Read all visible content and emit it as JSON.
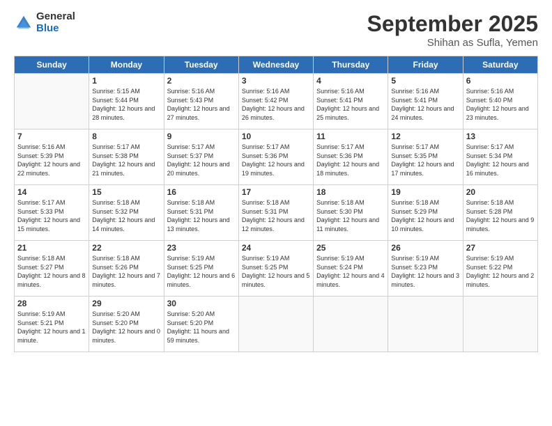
{
  "header": {
    "logo_general": "General",
    "logo_blue": "Blue",
    "month_title": "September 2025",
    "location": "Shihan as Sufla, Yemen"
  },
  "days_of_week": [
    "Sunday",
    "Monday",
    "Tuesday",
    "Wednesday",
    "Thursday",
    "Friday",
    "Saturday"
  ],
  "weeks": [
    [
      {
        "num": "",
        "empty": true
      },
      {
        "num": "1",
        "sunrise": "5:15 AM",
        "sunset": "5:44 PM",
        "daylight": "12 hours and 28 minutes."
      },
      {
        "num": "2",
        "sunrise": "5:16 AM",
        "sunset": "5:43 PM",
        "daylight": "12 hours and 27 minutes."
      },
      {
        "num": "3",
        "sunrise": "5:16 AM",
        "sunset": "5:42 PM",
        "daylight": "12 hours and 26 minutes."
      },
      {
        "num": "4",
        "sunrise": "5:16 AM",
        "sunset": "5:41 PM",
        "daylight": "12 hours and 25 minutes."
      },
      {
        "num": "5",
        "sunrise": "5:16 AM",
        "sunset": "5:41 PM",
        "daylight": "12 hours and 24 minutes."
      },
      {
        "num": "6",
        "sunrise": "5:16 AM",
        "sunset": "5:40 PM",
        "daylight": "12 hours and 23 minutes."
      }
    ],
    [
      {
        "num": "7",
        "sunrise": "5:16 AM",
        "sunset": "5:39 PM",
        "daylight": "12 hours and 22 minutes."
      },
      {
        "num": "8",
        "sunrise": "5:17 AM",
        "sunset": "5:38 PM",
        "daylight": "12 hours and 21 minutes."
      },
      {
        "num": "9",
        "sunrise": "5:17 AM",
        "sunset": "5:37 PM",
        "daylight": "12 hours and 20 minutes."
      },
      {
        "num": "10",
        "sunrise": "5:17 AM",
        "sunset": "5:36 PM",
        "daylight": "12 hours and 19 minutes."
      },
      {
        "num": "11",
        "sunrise": "5:17 AM",
        "sunset": "5:36 PM",
        "daylight": "12 hours and 18 minutes."
      },
      {
        "num": "12",
        "sunrise": "5:17 AM",
        "sunset": "5:35 PM",
        "daylight": "12 hours and 17 minutes."
      },
      {
        "num": "13",
        "sunrise": "5:17 AM",
        "sunset": "5:34 PM",
        "daylight": "12 hours and 16 minutes."
      }
    ],
    [
      {
        "num": "14",
        "sunrise": "5:17 AM",
        "sunset": "5:33 PM",
        "daylight": "12 hours and 15 minutes."
      },
      {
        "num": "15",
        "sunrise": "5:18 AM",
        "sunset": "5:32 PM",
        "daylight": "12 hours and 14 minutes."
      },
      {
        "num": "16",
        "sunrise": "5:18 AM",
        "sunset": "5:31 PM",
        "daylight": "12 hours and 13 minutes."
      },
      {
        "num": "17",
        "sunrise": "5:18 AM",
        "sunset": "5:31 PM",
        "daylight": "12 hours and 12 minutes."
      },
      {
        "num": "18",
        "sunrise": "5:18 AM",
        "sunset": "5:30 PM",
        "daylight": "12 hours and 11 minutes."
      },
      {
        "num": "19",
        "sunrise": "5:18 AM",
        "sunset": "5:29 PM",
        "daylight": "12 hours and 10 minutes."
      },
      {
        "num": "20",
        "sunrise": "5:18 AM",
        "sunset": "5:28 PM",
        "daylight": "12 hours and 9 minutes."
      }
    ],
    [
      {
        "num": "21",
        "sunrise": "5:18 AM",
        "sunset": "5:27 PM",
        "daylight": "12 hours and 8 minutes."
      },
      {
        "num": "22",
        "sunrise": "5:18 AM",
        "sunset": "5:26 PM",
        "daylight": "12 hours and 7 minutes."
      },
      {
        "num": "23",
        "sunrise": "5:19 AM",
        "sunset": "5:25 PM",
        "daylight": "12 hours and 6 minutes."
      },
      {
        "num": "24",
        "sunrise": "5:19 AM",
        "sunset": "5:25 PM",
        "daylight": "12 hours and 5 minutes."
      },
      {
        "num": "25",
        "sunrise": "5:19 AM",
        "sunset": "5:24 PM",
        "daylight": "12 hours and 4 minutes."
      },
      {
        "num": "26",
        "sunrise": "5:19 AM",
        "sunset": "5:23 PM",
        "daylight": "12 hours and 3 minutes."
      },
      {
        "num": "27",
        "sunrise": "5:19 AM",
        "sunset": "5:22 PM",
        "daylight": "12 hours and 2 minutes."
      }
    ],
    [
      {
        "num": "28",
        "sunrise": "5:19 AM",
        "sunset": "5:21 PM",
        "daylight": "12 hours and 1 minute."
      },
      {
        "num": "29",
        "sunrise": "5:20 AM",
        "sunset": "5:20 PM",
        "daylight": "12 hours and 0 minutes."
      },
      {
        "num": "30",
        "sunrise": "5:20 AM",
        "sunset": "5:20 PM",
        "daylight": "11 hours and 59 minutes."
      },
      {
        "num": "",
        "empty": true
      },
      {
        "num": "",
        "empty": true
      },
      {
        "num": "",
        "empty": true
      },
      {
        "num": "",
        "empty": true
      }
    ]
  ]
}
